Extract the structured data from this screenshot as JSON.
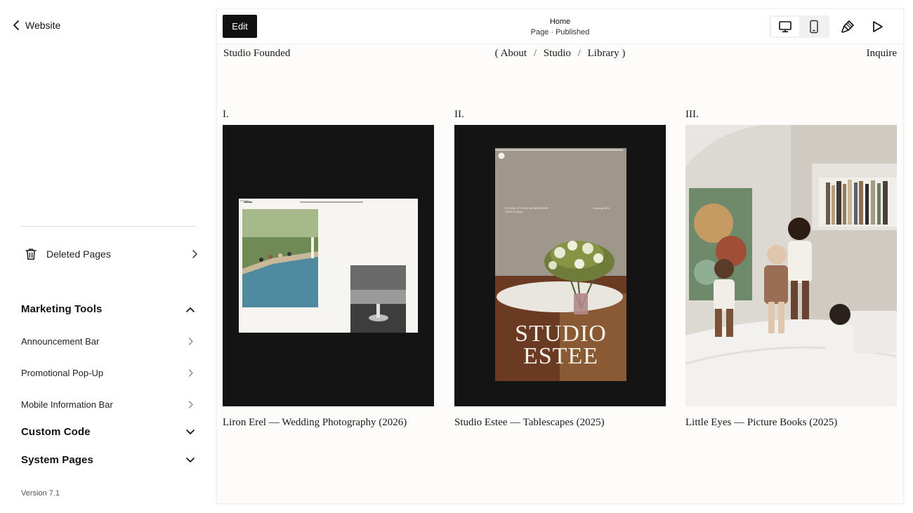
{
  "sidebar": {
    "back_label": "Website",
    "deleted_pages_label": "Deleted Pages",
    "marketing": {
      "title": "Marketing Tools",
      "items": [
        {
          "label": "Announcement Bar"
        },
        {
          "label": "Promotional Pop-Up"
        },
        {
          "label": "Mobile Information Bar"
        }
      ]
    },
    "custom_code_label": "Custom Code",
    "system_pages_label": "System Pages",
    "version": "Version 7.1"
  },
  "editor": {
    "edit_label": "Edit",
    "page_title": "Home",
    "page_status": "Page · Published"
  },
  "site": {
    "brand": "Studio Founded",
    "nav": {
      "open": "(",
      "items": [
        "About",
        "Studio",
        "Library"
      ],
      "separator": "/",
      "close": ")"
    },
    "inquire": "Inquire",
    "projects": [
      {
        "number": "I.",
        "caption": "Liron Erel — Wedding Photography (2026)"
      },
      {
        "number": "II.",
        "caption": "Studio Estee — Tablescapes (2025)"
      },
      {
        "number": "III.",
        "caption": "Little Eyes — Picture Books (2025)"
      }
    ],
    "mockup_text": {
      "mini_brand": "Liron Erel",
      "mini_nav": "Wedding Photographer  ·  About  ·  Weddings  ·  Portfolio  ·  Inquire",
      "membership": "FLORAL STYLING MEMBERSHIP",
      "course": "Online Course",
      "coming": "Coming 2024",
      "logo_line1": "STUDIO",
      "logo_line2": "ESTEE"
    }
  },
  "colors": {
    "accent": "#111111",
    "card_bg": "#141414",
    "frame_bg": "#fdfcfb"
  }
}
